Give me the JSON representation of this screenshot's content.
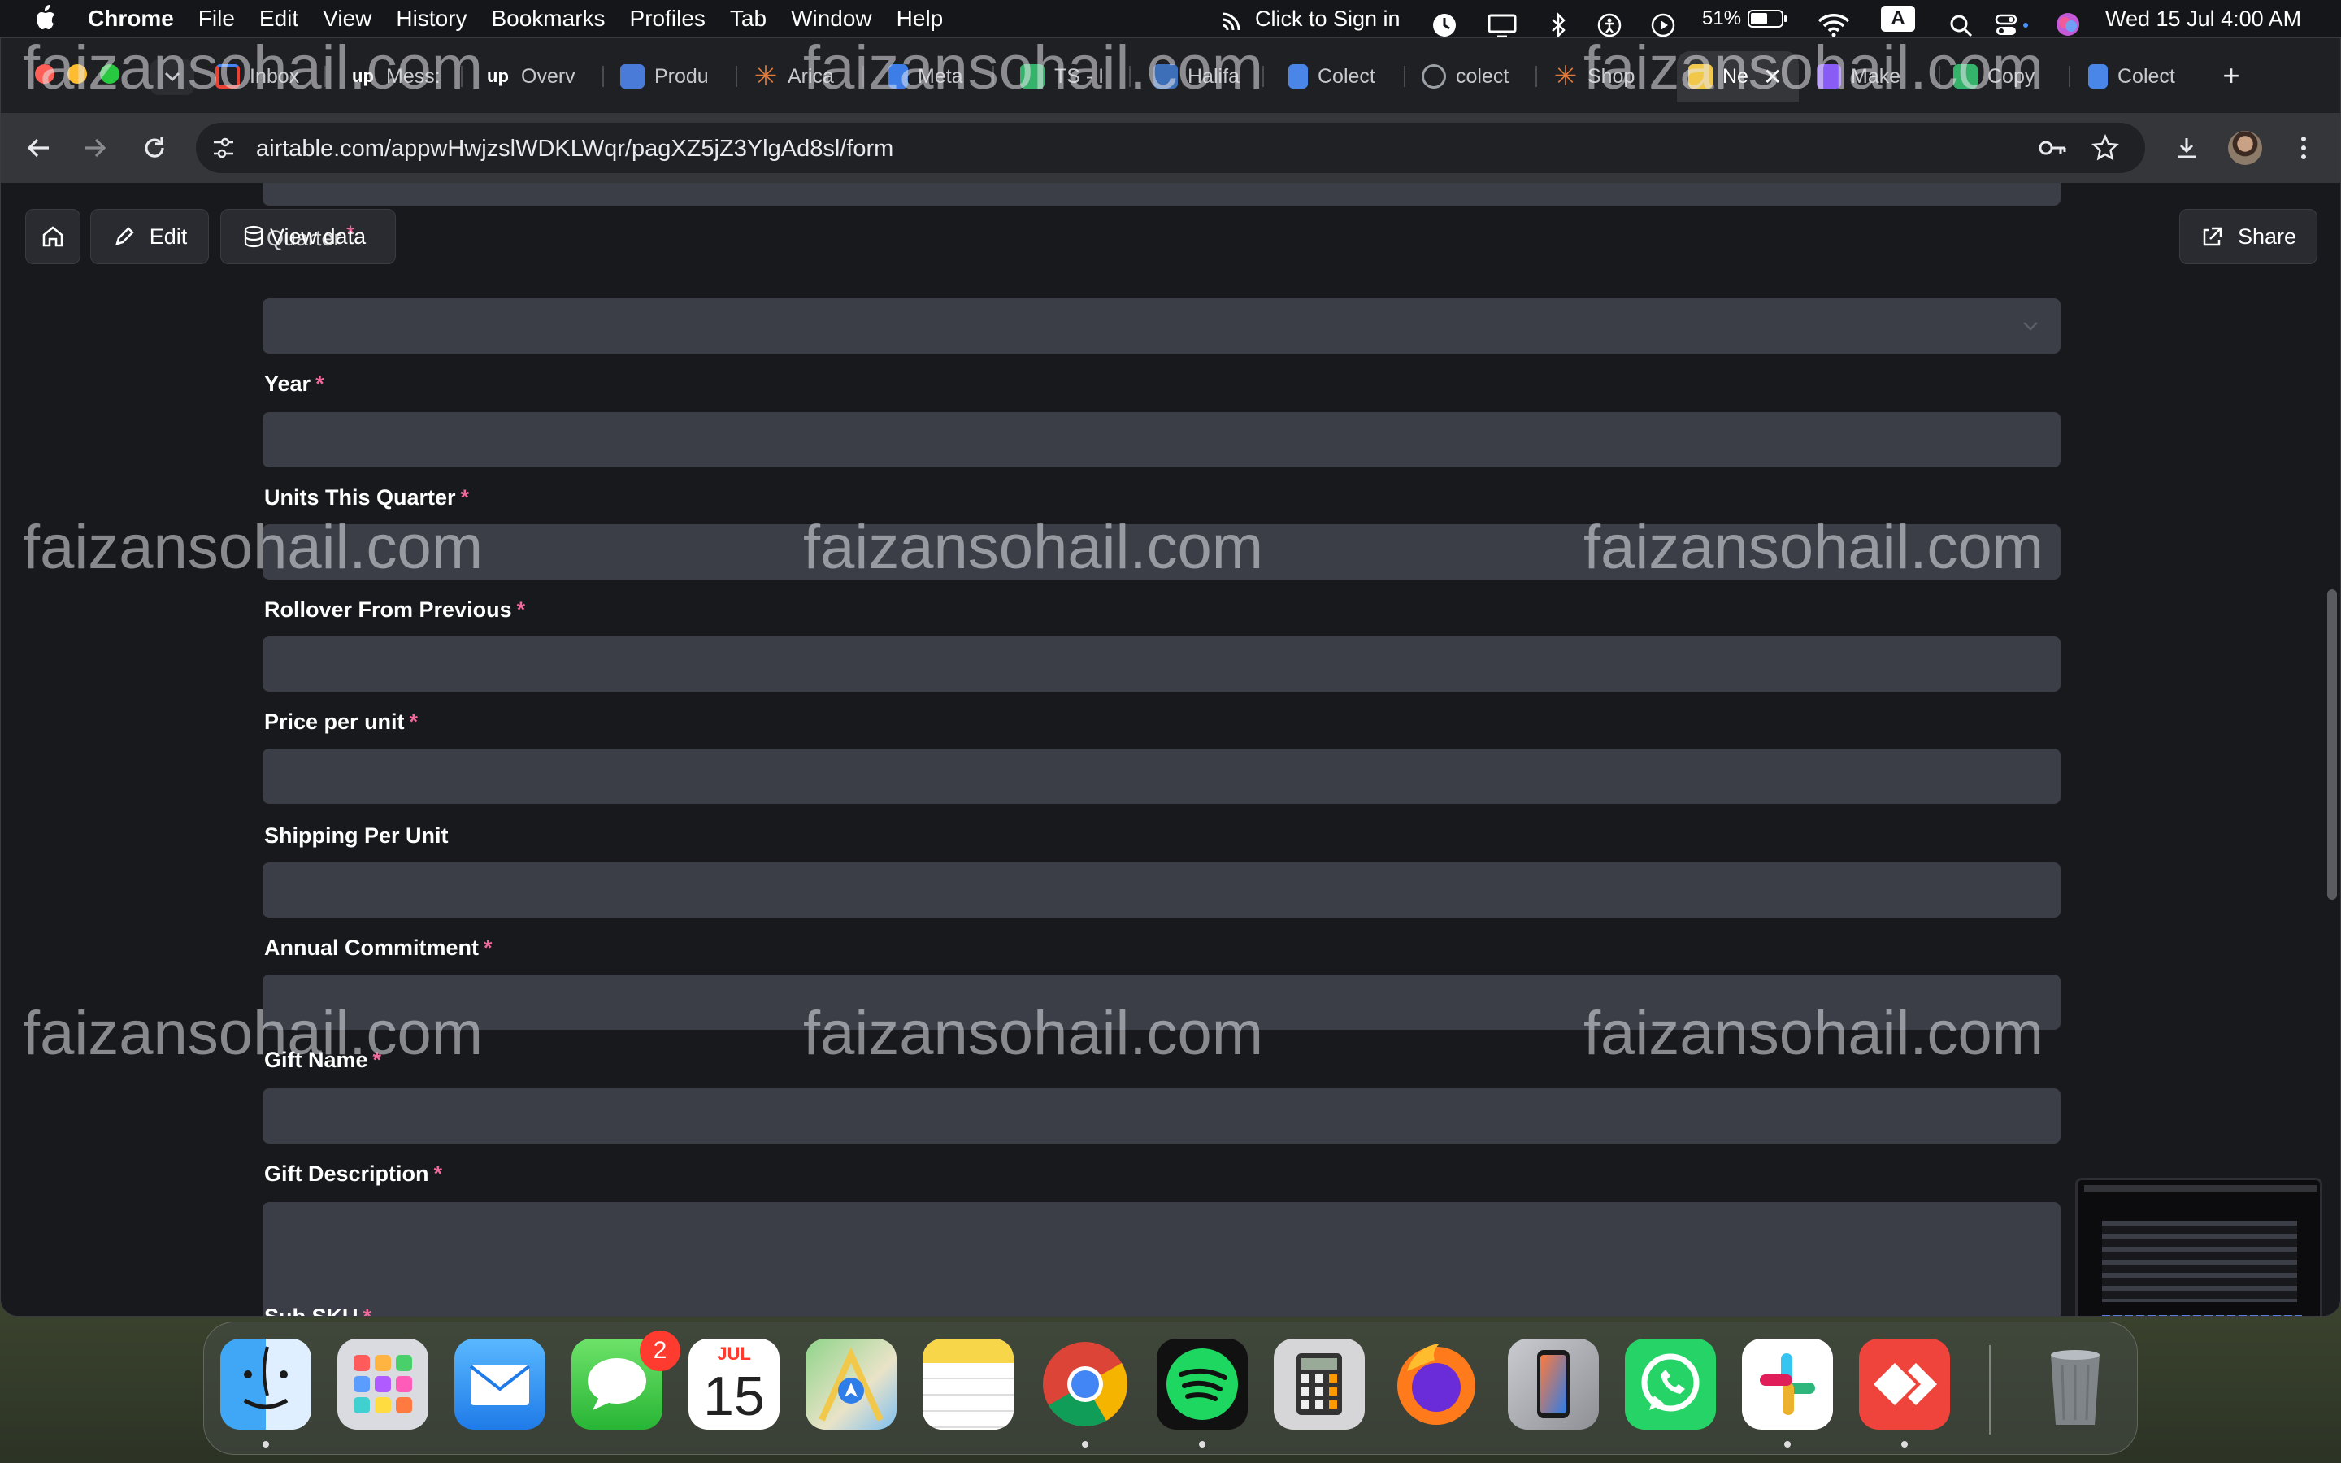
{
  "menubar": {
    "app_name": "Chrome",
    "menus": [
      "File",
      "Edit",
      "View",
      "History",
      "Bookmarks",
      "Profiles",
      "Tab",
      "Window",
      "Help"
    ],
    "sign_in": "Click to Sign in",
    "battery": "51%",
    "input_source": "A",
    "datetime": "Wed 15 Jul  4:00 AM"
  },
  "tabs": [
    {
      "label": "Inbox",
      "color": "#ea4335"
    },
    {
      "label": "Mess:",
      "color": "#ffffff"
    },
    {
      "label": "Overv",
      "color": "#ffffff"
    },
    {
      "label": "Produ",
      "color": "#4a7bd8"
    },
    {
      "label": "Arica",
      "color": "#e07a3c"
    },
    {
      "label": "Meta",
      "color": "#3d7de8"
    },
    {
      "label": "TS - I",
      "color": "#36b36b"
    },
    {
      "label": "Halifa",
      "color": "#3d6fb8"
    },
    {
      "label": "Colect",
      "color": "#4a86e8"
    },
    {
      "label": "colect",
      "color": "#9aa0a6"
    },
    {
      "label": "Shop",
      "color": "#e07a3c"
    },
    {
      "label": "Ne",
      "color": "#f2c84b"
    },
    {
      "label": "Make",
      "color": "#8a5cf6"
    },
    {
      "label": "Copy",
      "color": "#36b36b"
    },
    {
      "label": "Colect",
      "color": "#4a86e8"
    }
  ],
  "address": {
    "url": "airtable.com/appwHwjzslWDKLWqr/pagXZ5jZ3YlgAd8sl/form"
  },
  "page_header": {
    "edit_label": "Edit",
    "view_data_label": "View data",
    "overlap_text": "Quarter",
    "share_label": "Share"
  },
  "form": {
    "fields": [
      {
        "label": "Year",
        "required": "*"
      },
      {
        "label": "Units This Quarter",
        "required": "*"
      },
      {
        "label": "Rollover From Previous",
        "required": "*"
      },
      {
        "label": "Price per unit",
        "required": "*"
      },
      {
        "label": "Shipping Per Unit",
        "required": ""
      },
      {
        "label": "Annual Commitment",
        "required": "*"
      },
      {
        "label": "Gift Name",
        "required": "*"
      },
      {
        "label": "Gift Description",
        "required": "*"
      },
      {
        "label": "Sub SKU",
        "required": "*"
      }
    ]
  },
  "watermark": "faizansohail.com",
  "dock": {
    "messages_badge": "2",
    "calendar_month": "JUL",
    "calendar_day": "15",
    "apps": [
      "Finder",
      "Launchpad",
      "Mail",
      "Messages",
      "Calendar",
      "Maps",
      "Notes",
      "Chrome",
      "Spotify",
      "Calculator",
      "Firefox",
      "iPhone Mirroring",
      "WhatsApp",
      "Slack",
      "AnyDesk",
      "Trash"
    ]
  }
}
